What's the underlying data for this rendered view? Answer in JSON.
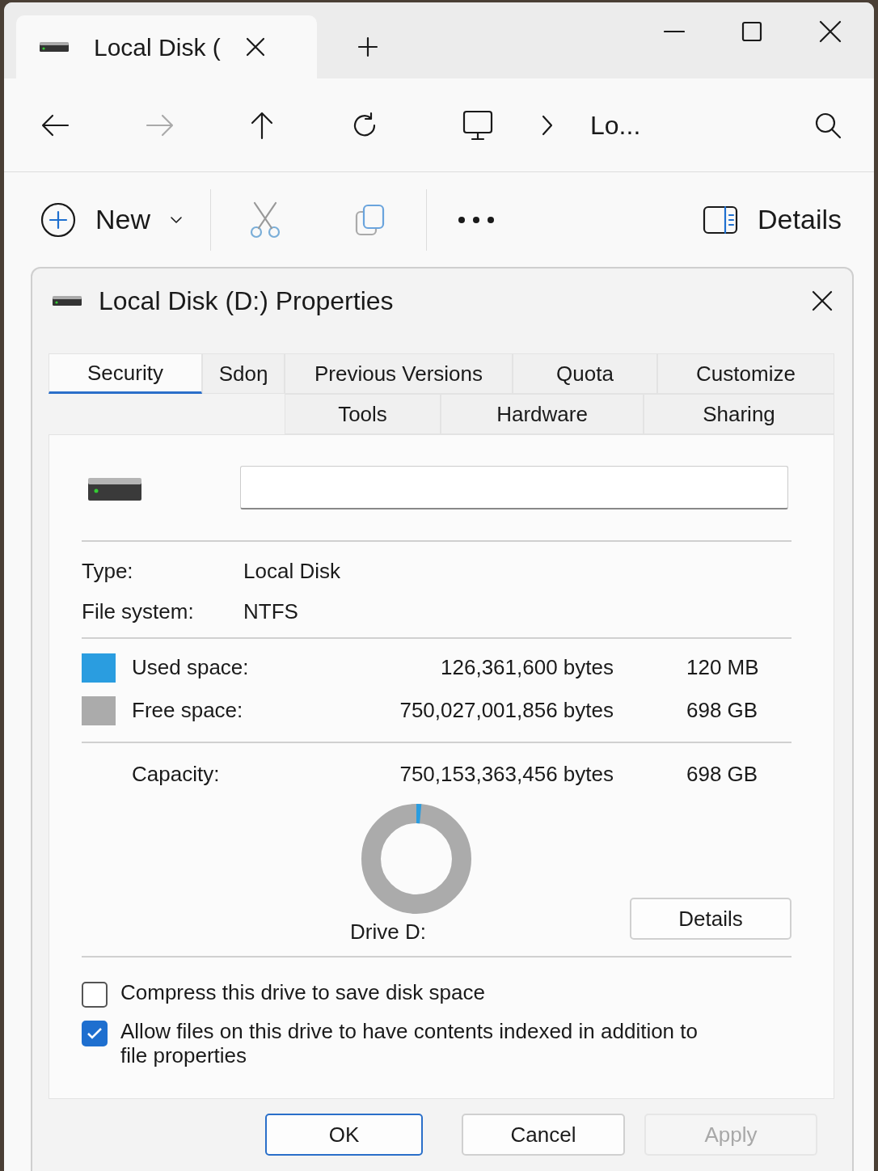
{
  "explorer": {
    "tab_title": "Local Disk (",
    "address": "Lo...",
    "new_label": "New",
    "details_label": "Details"
  },
  "dialog": {
    "title": "Local Disk (D:) Properties",
    "tab_rows": [
      [
        {
          "label": "Security",
          "selected": true
        },
        {
          "label": "Sdoŋ",
          "selected": false
        },
        {
          "label": "Previous Versions",
          "selected": false
        },
        {
          "label": "Quota",
          "selected": false
        },
        {
          "label": "Customize",
          "selected": false
        }
      ],
      [
        {
          "label": "Tools",
          "selected": false
        },
        {
          "label": "Hardware",
          "selected": false
        },
        {
          "label": "Sharing",
          "selected": false
        }
      ]
    ],
    "info": [
      {
        "label": "Type:",
        "value": "Local Disk"
      },
      {
        "label": "File system:",
        "value": "NTFS"
      }
    ],
    "space": [
      {
        "label": "Used space:",
        "bytes": "126,361,600 bytes",
        "size": "120 MB",
        "color": "#2a9de0"
      },
      {
        "label": "Free space:",
        "bytes": "750,027,001,856 bytes",
        "size": "698 GB",
        "color": "#ababab"
      }
    ],
    "capacity": {
      "label": "Capacity:",
      "bytes": "750,153,363,456 bytes",
      "size": "698 GB"
    },
    "usage": {
      "level": 0.015
    },
    "drive_label": "Drive D:",
    "details_button": "Details",
    "options": [
      {
        "label": "Compress this drive to save disk space",
        "checked": false
      },
      {
        "label": "Allow files on this drive to have contents indexed in addition to file properties",
        "checked": true
      }
    ],
    "buttons": [
      {
        "label": "OK",
        "default": true,
        "disabled": false
      },
      {
        "label": "Cancel",
        "default": false,
        "disabled": false
      },
      {
        "label": "Apply",
        "default": false,
        "disabled": true
      }
    ]
  }
}
